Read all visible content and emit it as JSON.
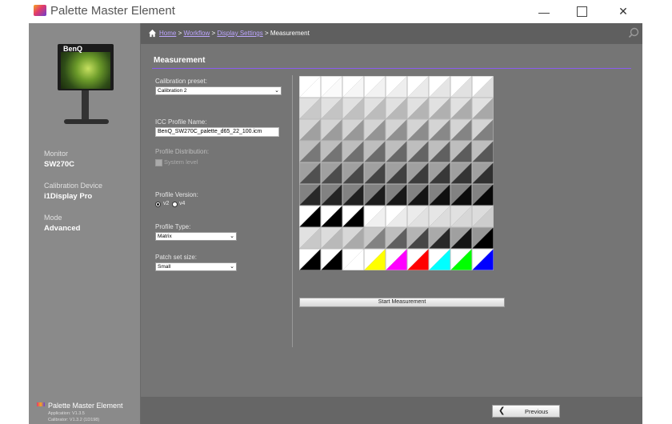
{
  "window": {
    "title": "Palette Master Element",
    "controls": {
      "minimize": "—",
      "maximize": "",
      "close": "✕"
    }
  },
  "breadcrumb": {
    "items": [
      "Home",
      "Workflow",
      "Display Settings"
    ],
    "separator": ">",
    "current": "Measurement"
  },
  "sidebar": {
    "monitor_logo": "BenQ",
    "monitor_label": "Monitor",
    "monitor_value": "SW270C",
    "calibration_label": "Calibration Device",
    "calibration_value": "i1Display Pro",
    "mode_label": "Mode",
    "mode_value": "Advanced",
    "footer_title": "Palette Master Element",
    "footer_app": "Application: V1.3.5",
    "footer_cal": "Calibrator: V1.3.2 (1D198)"
  },
  "main": {
    "section_title": "Measurement",
    "calibration_preset_label": "Calibration preset:",
    "calibration_preset_value": "Calibration 2",
    "icc_label": "ICC Profile Name:",
    "icc_value": "BenQ_SW270C_palette_d65_22_100.icm",
    "distribution_label": "Profile Distribution:",
    "system_level_label": "System level",
    "version_label": "Profile Version:",
    "version_options": [
      "v2",
      "v4"
    ],
    "version_selected": "v2",
    "type_label": "Profile Type:",
    "type_value": "Matrix",
    "patch_label": "Patch set size:",
    "patch_value": "Small",
    "start_button": "Start Measurement",
    "previous_button": "Previous"
  },
  "patch_colors": {
    "accent": "#8a5cf0",
    "colored_row": [
      "#000000",
      "#000000",
      "#ffffff",
      "#ffff00",
      "#ff00ff",
      "#ff0000",
      "#00ffff",
      "#00ff00",
      "#0000ff"
    ]
  },
  "icons": [
    "home-icon",
    "search-icon",
    "chevron-down-icon",
    "back-arrow-icon"
  ]
}
